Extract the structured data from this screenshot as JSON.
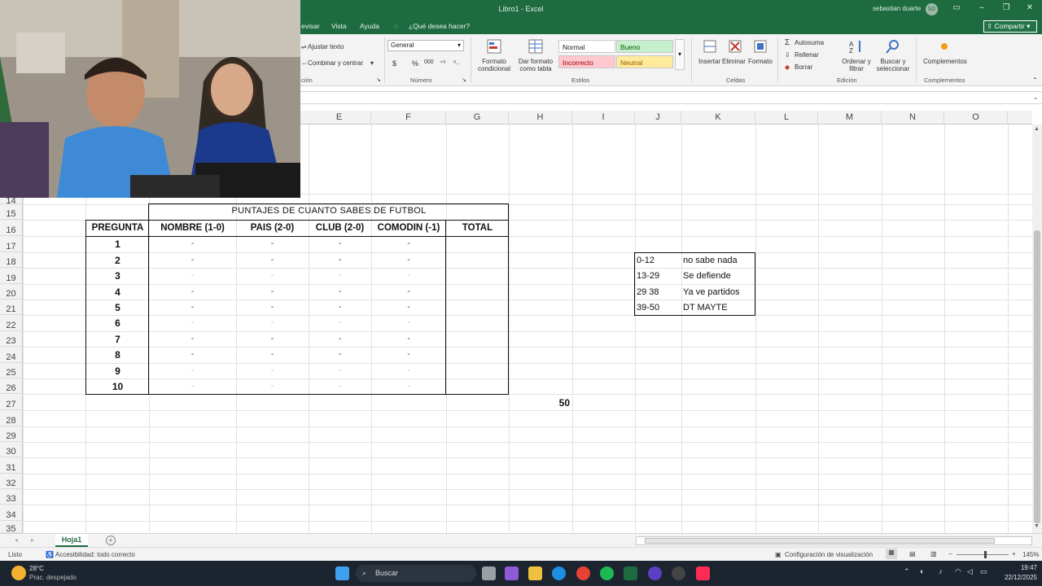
{
  "titlebar": {
    "title": "Libro1 - Excel",
    "user": "sebastian duarte",
    "avatar": "SD"
  },
  "ribbon_tabs": [
    "evisar",
    "Vista",
    "Ayuda",
    "¿Qué desea hacer?"
  ],
  "share_label": "Compartir",
  "ribbon": {
    "wrap_text": "Ajustar texto",
    "merge_center": "Combinar y centrar",
    "alignment_group": "ción",
    "number_format": "General",
    "currency": "$",
    "percent": "%",
    "thousands": "000",
    "number_group": "Número",
    "cond_format": [
      "Formato",
      "condicional"
    ],
    "table_format": [
      "Dar formato",
      "como tabla"
    ],
    "styles_group": "Estilos",
    "styles": {
      "normal": "Normal",
      "bueno": "Bueno",
      "incorrecto": "Incorrecto",
      "neutral": "Neutral"
    },
    "insert": "Insertar",
    "delete": "Eliminar",
    "format": "Formato",
    "cells_group": "Celdas",
    "autosum": "Autosuma",
    "fill": "Rellenar",
    "clear": "Borrar",
    "sort": [
      "Ordenar y",
      "filtrar"
    ],
    "find": [
      "Buscar y",
      "seleccionar"
    ],
    "editing_group": "Edición",
    "addins": "Complementos",
    "addins_group": "Complementos"
  },
  "columns": [
    "E",
    "F",
    "G",
    "H",
    "I",
    "J",
    "K",
    "L",
    "M",
    "N",
    "O"
  ],
  "rows": [
    "14",
    "15",
    "16",
    "17",
    "18",
    "19",
    "20",
    "21",
    "22",
    "23",
    "24",
    "25",
    "26",
    "27",
    "28",
    "29",
    "30",
    "31",
    "32",
    "33",
    "34",
    "35"
  ],
  "table": {
    "title": "PUNTAJES DE CUANTO SABES DE FUTBOL",
    "headers": [
      "PREGUNTA",
      "NOMBRE (1-0)",
      "PAIS (2-0)",
      "CLUB (2-0)",
      "COMODIN (-1)",
      "TOTAL"
    ],
    "questions": [
      "1",
      "2",
      "3",
      "4",
      "5",
      "6",
      "7",
      "8",
      "9",
      "10"
    ],
    "dash": "-",
    "max_score": "50"
  },
  "legend": [
    {
      "range": "0-12",
      "label": "no sabe nada"
    },
    {
      "range": "13-29",
      "label": "Se defiende"
    },
    {
      "range": "29 38",
      "label": "Ya ve partidos"
    },
    {
      "range": "39-50",
      "label": "DT MAYTE"
    }
  ],
  "sheet_tab": "Hoja1",
  "status": {
    "ready": "Listo",
    "accessibility": "Accesibilidad: todo correcto",
    "display_settings": "Configuración de visualización",
    "zoom": "145%"
  },
  "taskbar": {
    "temp": "28°C",
    "weather": "Prac. despejado",
    "search": "Buscar",
    "time": "19:47",
    "date": "22/12/2025"
  },
  "colors": {
    "excel_green": "#1e6b40",
    "good_bg": "#c6efce",
    "bad_bg": "#ffc7ce",
    "neutral_bg": "#ffeb9c"
  }
}
